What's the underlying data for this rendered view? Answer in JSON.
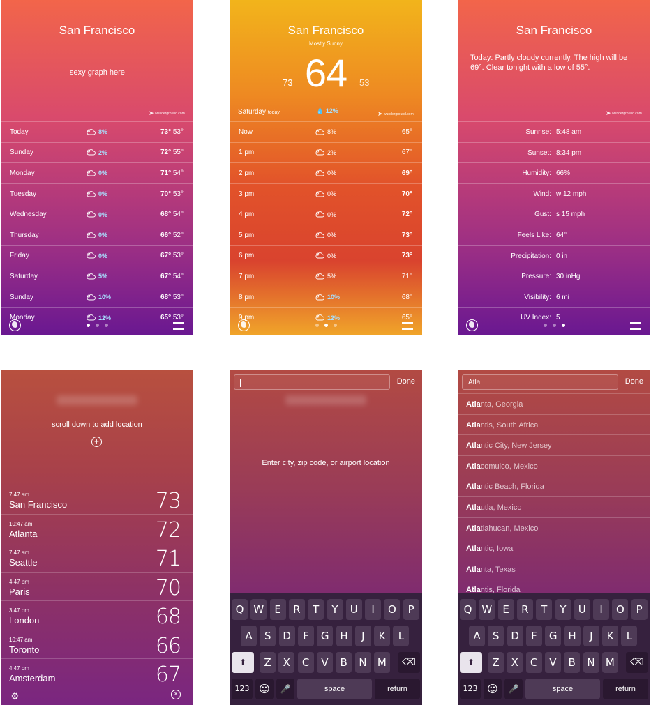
{
  "screen1": {
    "city": "San Francisco",
    "graph_placeholder": "sexy graph here",
    "wu_logo": "wunderground.com",
    "days": [
      {
        "day": "Today",
        "precip": "8%",
        "hi": "73°",
        "lo": "53°"
      },
      {
        "day": "Sunday",
        "precip": "2%",
        "hi": "72°",
        "lo": "55°"
      },
      {
        "day": "Monday",
        "precip": "0%",
        "hi": "71°",
        "lo": "54°"
      },
      {
        "day": "Tuesday",
        "precip": "0%",
        "hi": "70°",
        "lo": "53°"
      },
      {
        "day": "Wednesday",
        "precip": "0%",
        "hi": "68°",
        "lo": "54°"
      },
      {
        "day": "Thursday",
        "precip": "0%",
        "hi": "66°",
        "lo": "52°"
      },
      {
        "day": "Friday",
        "precip": "0%",
        "hi": "67°",
        "lo": "53°"
      },
      {
        "day": "Saturday",
        "precip": "5%",
        "hi": "67°",
        "lo": "54°"
      },
      {
        "day": "Sunday",
        "precip": "10%",
        "hi": "68°",
        "lo": "53°"
      },
      {
        "day": "Monday",
        "precip": "12%",
        "hi": "65°",
        "lo": "53°"
      }
    ],
    "page_index": 0
  },
  "screen2": {
    "city": "San Francisco",
    "condition": "Mostly Sunny",
    "temp": "64",
    "low": "73",
    "high": "53",
    "day_label": "Saturday",
    "day_sub": "today",
    "day_precip": "12%",
    "wu_logo": "wunderground.com",
    "hours": [
      {
        "time": "Now",
        "precip": "8%",
        "temp": "65°"
      },
      {
        "time": "1 pm",
        "precip": "2%",
        "temp": "67°"
      },
      {
        "time": "2 pm",
        "precip": "0%",
        "temp": "69°"
      },
      {
        "time": "3 pm",
        "precip": "0%",
        "temp": "70°"
      },
      {
        "time": "4 pm",
        "precip": "0%",
        "temp": "72°"
      },
      {
        "time": "5 pm",
        "precip": "0%",
        "temp": "73°"
      },
      {
        "time": "6 pm",
        "precip": "0%",
        "temp": "73°"
      },
      {
        "time": "7 pm",
        "precip": "5%",
        "temp": "71°"
      },
      {
        "time": "8 pm",
        "precip": "10%",
        "temp": "68°"
      },
      {
        "time": "9 pm",
        "precip": "12%",
        "temp": "65°"
      }
    ],
    "page_index": 1
  },
  "screen3": {
    "city": "San Francisco",
    "description": "Today: Partly cloudy currently. The high will be 69°. Clear tonight with a low of 55°.",
    "wu_logo": "wunderground.com",
    "details": [
      {
        "label": "Sunrise:",
        "value": "5:48 am"
      },
      {
        "label": "Sunset:",
        "value": "8:34 pm"
      },
      {
        "label": "Humidity:",
        "value": "66%"
      },
      {
        "label": "Wind:",
        "value": "w 12 mph"
      },
      {
        "label": "Gust:",
        "value": "s 15 mph"
      },
      {
        "label": "Feels Like:",
        "value": "64°"
      },
      {
        "label": "Precipitation:",
        "value": "0 in"
      },
      {
        "label": "Pressure:",
        "value": "30 inHg"
      },
      {
        "label": "Visibility:",
        "value": "6 mi"
      },
      {
        "label": "UV Index:",
        "value": "5"
      }
    ],
    "page_index": 2
  },
  "screen4": {
    "hint": "scroll down to add location",
    "locations": [
      {
        "time": "7:47 am",
        "city": "San Francisco",
        "temp": "73"
      },
      {
        "time": "10:47 am",
        "city": "Atlanta",
        "temp": "72"
      },
      {
        "time": "7:47 am",
        "city": "Seattle",
        "temp": "71"
      },
      {
        "time": "4:47 pm",
        "city": "Paris",
        "temp": "70"
      },
      {
        "time": "3:47 pm",
        "city": "London",
        "temp": "68"
      },
      {
        "time": "10:47 am",
        "city": "Toronto",
        "temp": "66"
      },
      {
        "time": "4:47 pm",
        "city": "Amsterdam",
        "temp": "67"
      }
    ]
  },
  "screen5": {
    "search_value": "",
    "done_label": "Done",
    "hint": "Enter city, zip code, or airport location"
  },
  "screen6": {
    "search_value": "Atla",
    "done_label": "Done",
    "results": [
      {
        "match": "Atla",
        "rest": "nta, Georgia"
      },
      {
        "match": "Atla",
        "rest": "ntis, South Africa"
      },
      {
        "match": "Atla",
        "rest": "ntic City, New Jersey"
      },
      {
        "match": "Atla",
        "rest": "comulco, Mexico"
      },
      {
        "match": "Atla",
        "rest": "ntic Beach, Florida"
      },
      {
        "match": "Atla",
        "rest": "utla, Mexico"
      },
      {
        "match": "Atla",
        "rest": "tlahucan, Mexico"
      },
      {
        "match": "Atla",
        "rest": "ntic, Iowa"
      },
      {
        "match": "Atla",
        "rest": "nta, Texas"
      },
      {
        "match": "Atla",
        "rest": "ntis, Florida"
      }
    ]
  },
  "keyboard": {
    "row1": [
      "Q",
      "W",
      "E",
      "R",
      "T",
      "Y",
      "U",
      "I",
      "O",
      "P"
    ],
    "row2": [
      "A",
      "S",
      "D",
      "F",
      "G",
      "H",
      "J",
      "K",
      "L"
    ],
    "row3": [
      "Z",
      "X",
      "C",
      "V",
      "B",
      "N",
      "M"
    ],
    "shift": "⬆",
    "delete": "⌫",
    "numbers": "123",
    "emoji": "☺",
    "mic": "🎤",
    "space": "space",
    "return": "return"
  }
}
